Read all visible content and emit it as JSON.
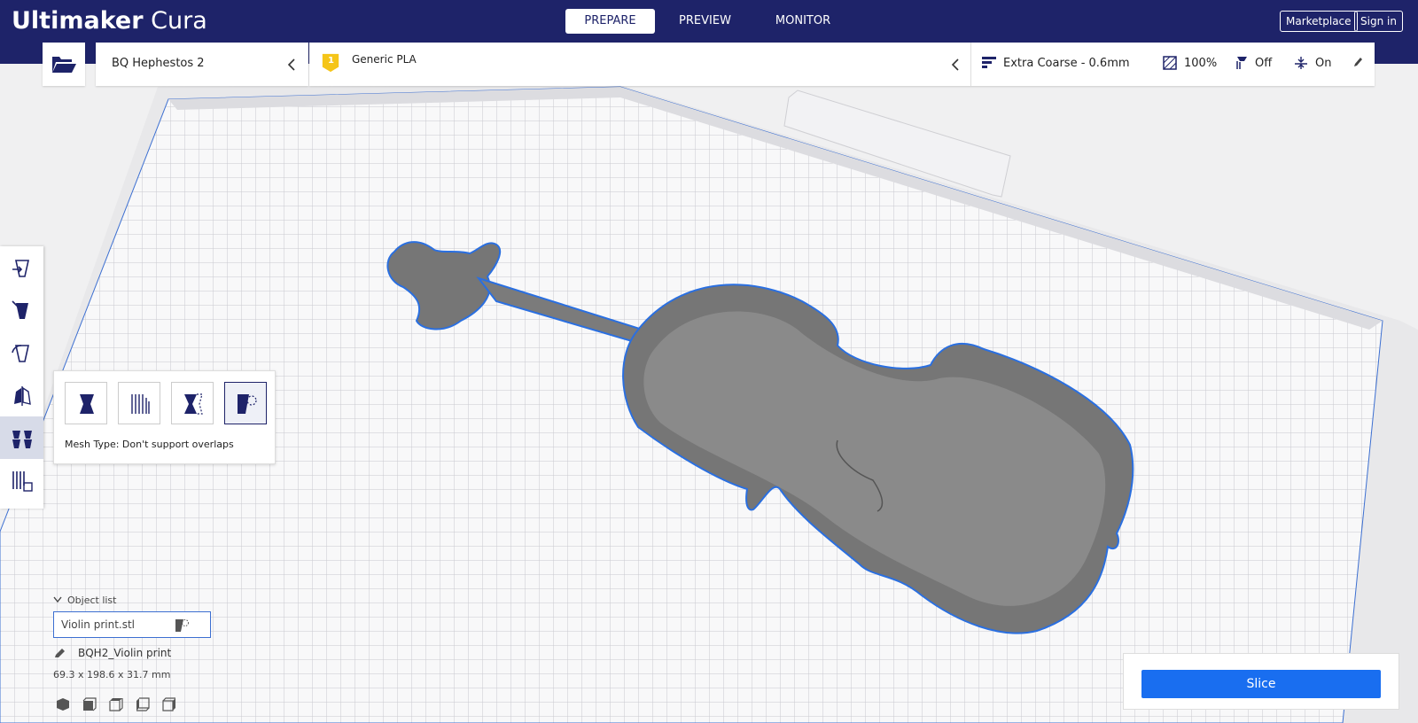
{
  "app": {
    "logo_bold": "Ultimaker",
    "logo_light": "Cura"
  },
  "stages": {
    "prepare": "PREPARE",
    "preview": "PREVIEW",
    "monitor": "MONITOR"
  },
  "header": {
    "marketplace": "Marketplace",
    "sign_in": "Sign in"
  },
  "toolbar": {
    "printer": "BQ Hephestos 2",
    "extruder_number": "1",
    "material": "Generic PLA",
    "profile": "Extra Coarse - 0.6mm",
    "infill": "100%",
    "support": "Off",
    "adhesion": "On"
  },
  "left_tools": [
    "move-tool",
    "scale-tool",
    "rotate-tool",
    "mirror-tool",
    "per-model-settings-tool",
    "support-blocker-tool"
  ],
  "mesh_panel": {
    "label": "Mesh Type: Don't support overlaps",
    "types": [
      "normal-model",
      "print-as-support",
      "modify-settings-for-overlaps",
      "dont-support-overlaps"
    ]
  },
  "object_list": {
    "header": "Object list",
    "object_name": "Violin  print.stl",
    "job_name": "BQH2_Violin  print",
    "dimensions": "69.3 x 198.6 x 31.7 mm"
  },
  "view_buttons": [
    "3d-view",
    "front-view",
    "top-view",
    "left-view",
    "right-view"
  ],
  "slice": {
    "label": "Slice"
  },
  "colors": {
    "header": "#1e2369",
    "accent": "#196ef0",
    "model": "#6b6b6b",
    "outline": "#2a6fe0"
  }
}
